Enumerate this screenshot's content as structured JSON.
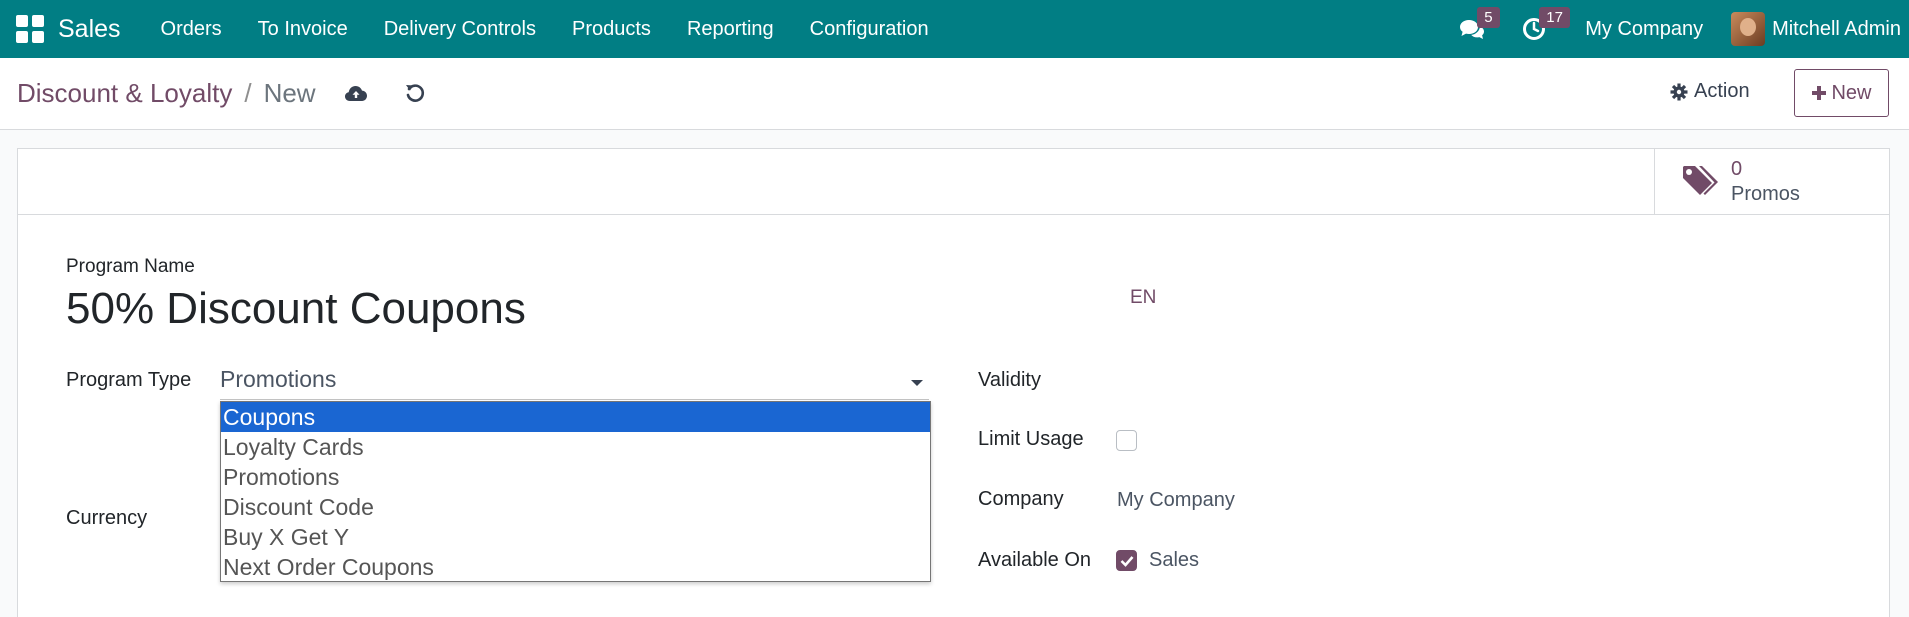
{
  "navbar": {
    "app_name": "Sales",
    "menu": [
      "Orders",
      "To Invoice",
      "Delivery Controls",
      "Products",
      "Reporting",
      "Configuration"
    ],
    "messages_count": "5",
    "activities_count": "17",
    "company": "My Company",
    "user": "Mitchell Admin"
  },
  "breadcrumb": {
    "parent": "Discount & Loyalty",
    "separator": "/",
    "current": "New"
  },
  "control_panel": {
    "action_label": "Action",
    "new_label": "New"
  },
  "stat_button": {
    "count": "0",
    "label": "Promos"
  },
  "form": {
    "program_name_label": "Program Name",
    "program_name_value": "50% Discount Coupons",
    "lang": "EN",
    "program_type_label": "Program Type",
    "program_type_value": "Promotions",
    "program_type_options": [
      "Coupons",
      "Loyalty Cards",
      "Promotions",
      "Discount Code",
      "Buy X Get Y",
      "Next Order Coupons"
    ],
    "highlighted_option": "Coupons",
    "currency_label": "Currency",
    "validity_label": "Validity",
    "limit_usage_label": "Limit Usage",
    "limit_usage_checked": false,
    "company_label": "Company",
    "company_value": "My Company",
    "available_on_label": "Available On",
    "available_on_sales_checked": true,
    "available_on_sales_label": "Sales"
  },
  "colors": {
    "navbar": "#017e84",
    "brand": "#714b67",
    "highlight": "#1a66d2"
  }
}
